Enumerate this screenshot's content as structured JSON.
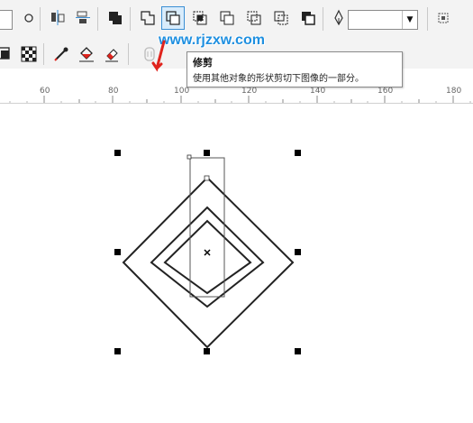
{
  "toolbar_top": {
    "buttons": [
      {
        "name": "small-circle-icon"
      },
      {
        "name": "align-icon"
      },
      {
        "name": "distribute-icon"
      },
      {
        "name": "combine-icon"
      },
      {
        "name": "weld-icon"
      },
      {
        "name": "trim-icon",
        "active": true
      },
      {
        "name": "intersect-icon"
      },
      {
        "name": "simplify-icon"
      },
      {
        "name": "front-minus-back-icon"
      },
      {
        "name": "back-minus-front-icon"
      },
      {
        "name": "boundary-icon"
      },
      {
        "name": "pen-nib-icon"
      },
      {
        "name": "snap-options-icon"
      }
    ],
    "outline_width_value": ""
  },
  "toolbar_second": {
    "buttons": [
      {
        "name": "frame-icon"
      },
      {
        "name": "checker-pattern-icon"
      },
      {
        "name": "eyedropper-icon"
      },
      {
        "name": "fill-bucket-icon"
      },
      {
        "name": "eraser-icon"
      },
      {
        "name": "copy-properties-icon"
      }
    ]
  },
  "watermark": "www.rjzxw.com",
  "tooltip": {
    "title": "修剪",
    "description": "使用其他对象的形状剪切下图像的一部分。"
  },
  "ruler": {
    "labels": [
      "60",
      "80",
      "100",
      "120",
      "140",
      "160",
      "180"
    ]
  },
  "colors": {
    "toolbar_bg": "#f3f3f3",
    "active_outline": "#3b8fd4",
    "watermark": "#1e8fe0",
    "accent_red": "#e0231c"
  }
}
